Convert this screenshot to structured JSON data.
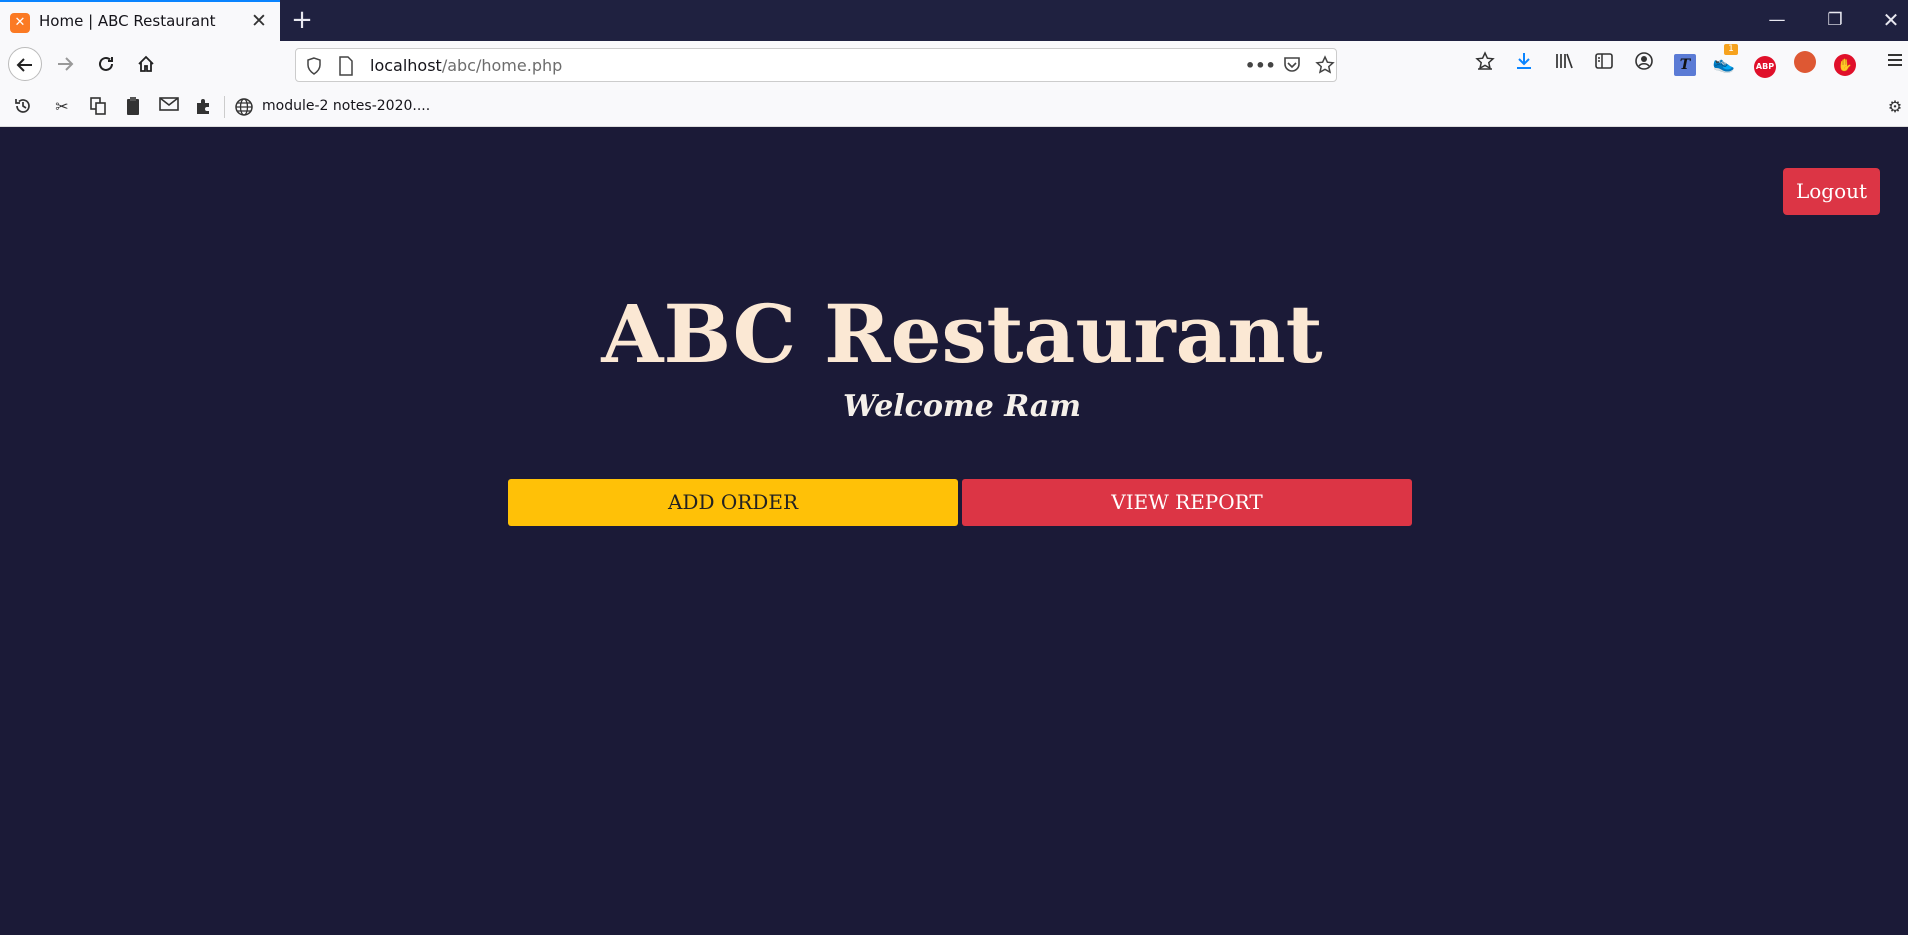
{
  "browser": {
    "tab": {
      "title": "Home | ABC Restaurant",
      "favicon": "xampp-icon"
    },
    "url": {
      "host": "localhost",
      "path": "/abc/home.php"
    },
    "bookmarks": [
      {
        "label": "module-2 notes-2020...."
      }
    ],
    "extension_badge": "1",
    "ext_abp_label": "ABP"
  },
  "page": {
    "title": "ABC Restaurant",
    "welcome": "Welcome Ram",
    "logout_label": "Logout",
    "add_order_label": "ADD ORDER",
    "view_report_label": "VIEW REPORT"
  },
  "colors": {
    "page_bg": "#1b1a37",
    "title_color": "#fbe8d4",
    "add_order_bg": "#ffc107",
    "view_report_bg": "#dc3545",
    "logout_bg": "#dc3545"
  }
}
